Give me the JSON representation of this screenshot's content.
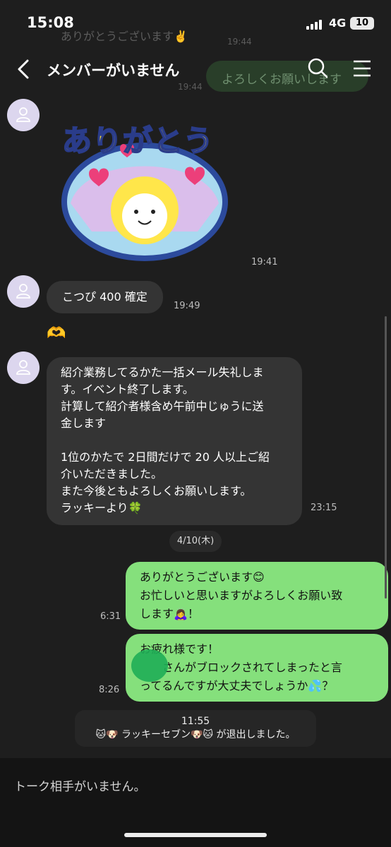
{
  "status_bar": {
    "time": "15:08",
    "network": "4G",
    "battery": "10"
  },
  "ghost": {
    "message_top": "ありがとうございます✌️",
    "time_1": "19:44",
    "time_2": "19:44",
    "right_bubble": "よろしくお願いします"
  },
  "header": {
    "title": "メンバーがいません",
    "search_icon": "search-icon",
    "menu_icon": "menu-icon",
    "back_icon": "chevron-left-icon"
  },
  "messages": {
    "sticker": {
      "text": "ありがとう",
      "time": "19:41"
    },
    "m1": {
      "text": "こつぴ 400 確定",
      "time": "19:49"
    },
    "reaction": "🫶",
    "m2": {
      "text": "紹介業務してるかた一括メール失礼しま\nす。イベント終了します。\n計算して紹介者様含め午前中じゅうに送\n金します\n\n1位のかたで 2日間だけで 20 人以上ご紹\n介いただきました。\nまた今後ともよろしくお願いします。\nラッキーより🍀",
      "time": "23:15"
    },
    "date_separator": "4/10(木)",
    "m3": {
      "text": "ありがとうございます😊\nお忙しいと思いますがよろしくお願い致\nします🙇‍♀️！",
      "time": "6:31"
    },
    "m4": {
      "text": "お疲れ様です！\n　　さんがブロックされてしまったと言\nってるんですが大丈夫でしょうか💦？",
      "time": "8:26"
    },
    "system": {
      "time": "11:55",
      "text": "🐱🐶 ラッキーセブン🐶🐱 が退出しました。"
    }
  },
  "footer": {
    "text": "トーク相手がいません。"
  },
  "colors": {
    "background": "#1e1e1e",
    "my_bubble": "#85e07c",
    "their_bubble": "#343434",
    "avatar": "#dcd6ee"
  }
}
